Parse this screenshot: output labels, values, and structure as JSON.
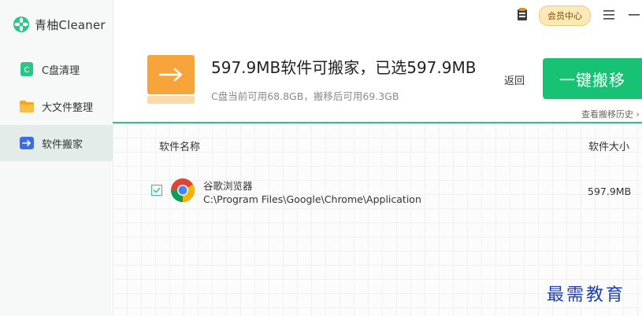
{
  "app": {
    "name": "青柚Cleaner"
  },
  "sidebar": {
    "items": [
      {
        "label": "C盘清理",
        "icon": "c-drive-icon",
        "active": false
      },
      {
        "label": "大文件整理",
        "icon": "folder-icon",
        "active": false
      },
      {
        "label": "软件搬家",
        "icon": "software-move-icon",
        "active": true
      }
    ]
  },
  "topbar": {
    "vip_label": "会员中心",
    "icons": [
      "skin-icon",
      "menu-icon",
      "minimize-icon"
    ]
  },
  "summary": {
    "headline": "597.9MB软件可搬家，已选597.9MB",
    "subline": "C盘当前可用68.8GB，搬移后可用69.3GB",
    "back_label": "返回",
    "primary_button": "一键搬移",
    "history_link": "查看搬移历史 ›"
  },
  "table": {
    "headers": {
      "name": "软件名称",
      "size": "软件大小"
    },
    "rows": [
      {
        "checked": true,
        "icon": "chrome-icon",
        "name": "谷歌浏览器",
        "path": "C:\\Program Files\\Google\\Chrome\\Application",
        "size": "597.9MB"
      }
    ]
  },
  "watermark": "最需教育",
  "colors": {
    "accent": "#18c275",
    "active_bg": "#e3ece8",
    "vip_bg": "#fde9b8"
  }
}
